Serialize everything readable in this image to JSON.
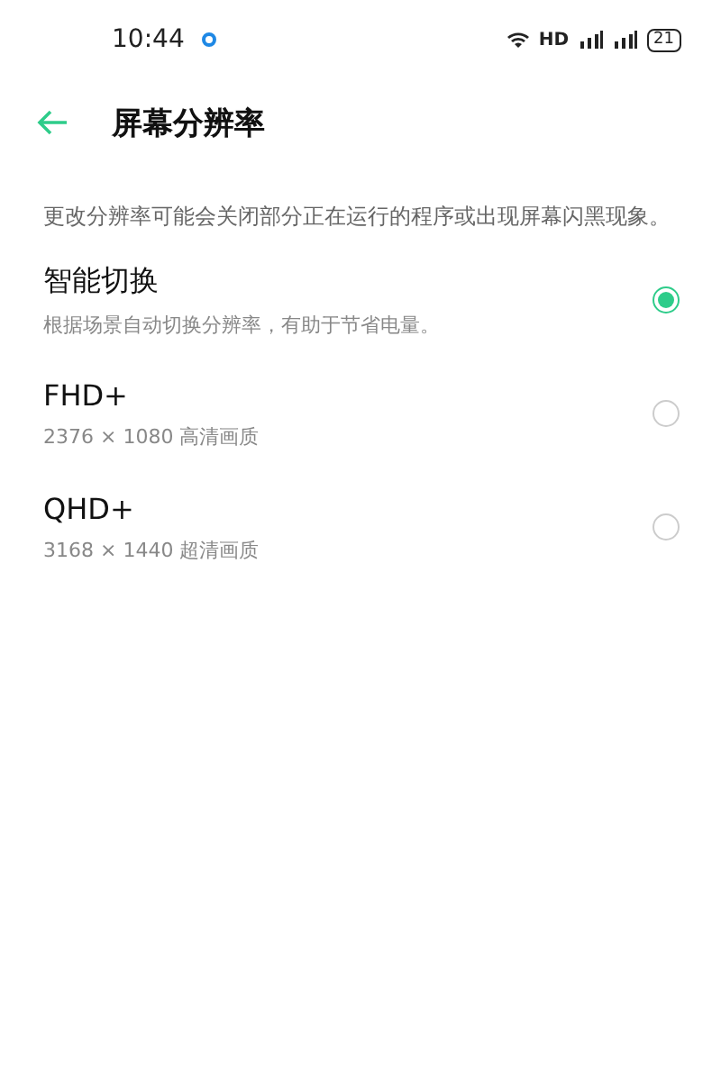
{
  "status_bar": {
    "time": "10:44",
    "network": "HD",
    "battery": "21"
  },
  "header": {
    "title": "屏幕分辨率"
  },
  "note": "更改分辨率可能会关闭部分正在运行的程序或出现屏幕闪黑现象。",
  "options": [
    {
      "label": "智能切换",
      "description": "根据场景自动切换分辨率，有助于节省电量。",
      "selected": true
    },
    {
      "label": "FHD+",
      "description": "2376 × 1080 高清画质",
      "selected": false
    },
    {
      "label": "QHD+",
      "description": "3168 × 1440 超清画质",
      "selected": false
    }
  ]
}
